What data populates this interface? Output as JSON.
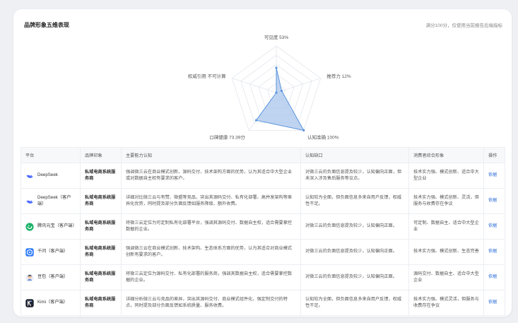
{
  "card": {
    "title": "品牌形象五维表现",
    "note": "满分100分，仅使用当前报告后端指标"
  },
  "chart_data": {
    "type": "radar",
    "max": 100,
    "axes": [
      {
        "name": "可见度",
        "value": 53,
        "value_label": "53%"
      },
      {
        "name": "推荐力",
        "value": 12,
        "value_label": "12%"
      },
      {
        "name": "认知准确",
        "value": 100,
        "value_label": "100%"
      },
      {
        "name": "口碑健康",
        "value": 73.39,
        "value_label": "73.39分"
      },
      {
        "name": "权威引用",
        "value": null,
        "value_label": "不可计算"
      }
    ],
    "fill_color": "#a9c6ec",
    "stroke_color": "#5b95dd"
  },
  "table": {
    "headers": [
      "平台",
      "品牌印象",
      "主要能力认知",
      "认知缺口",
      "消费者综合形象",
      "操作"
    ],
    "rows": [
      {
        "platform": "DeepSeek",
        "icon": "deepseek-icon",
        "icon_color": "#4d6bfe",
        "brand": "私域电商系统服务商",
        "ability": "强调微三云在商业模式创新、源码交付、技术架构方面的优势，认为其适合中大型企业或对数据自主权有要求的客户。",
        "gap": "对微三云的负面信息提及较少，认知偏向正面，但未深入涉及售后服务等议点。",
        "image": "技术实力强、模式创新、适合中大型企业",
        "action": "依据"
      },
      {
        "platform": "DeepSeek（客户端）",
        "icon": "deepseek-icon",
        "icon_color": "#4d6bfe",
        "brand": "私域电商系统服务商",
        "ability": "详细对比微三云与有赞、微盟等竞品，突出其源码交付、私有化部署、高并发架构等差异化优势，同时提及部分负面反馈如服务降级、额外收费。",
        "gap": "认知较为全面，但负面信息多来自用户反馈，权威性不足。",
        "image": "技术实力强、模式创新、灵活，但服务与收费存在争议",
        "action": "依据"
      },
      {
        "platform": "腾讯元宝（客户端）",
        "icon": "yuanbao-icon",
        "icon_color": "#1fb36b",
        "brand": "私域电商系统服务商",
        "ability": "将微三云定位为可定制私有化部署平台，强调其源码交付、数据自主权，适合需要掌控数据的企业。",
        "gap": "对微三云的负面信息提及较少，认知偏向正面。",
        "image": "可定制、数据自主、适合中大型企业",
        "action": "依据"
      },
      {
        "platform": "千问（客户端）",
        "icon": "qianwen-icon",
        "icon_color": "#2f7cf6",
        "brand": "私域电商系统服务商",
        "ability": "强调微三云在商业模式创新、技术架构、生态体系方面的优势，认为其适合对商业模式创新有要求的客户。",
        "gap": "对微三云的负面信息提及较少，认知偏向正面。",
        "image": "技术实力强、模式创新、生态完善",
        "action": "依据"
      },
      {
        "platform": "豆包（客户端）",
        "icon": "doubao-icon",
        "icon_color": "#e9eef6",
        "brand": "私域电商系统服务商",
        "ability": "将微三云定位为源码交付、私有化部署的服务商，强调其数据自主权，适合需要掌控数据的企业。",
        "gap": "对微三云的负面信息提及较少，认知偏向正面。",
        "image": "源码交付、数据自主、适合中大型企业",
        "action": "依据"
      },
      {
        "platform": "Kimi（客户端）",
        "icon": "kimi-icon",
        "icon_color": "#1f2330",
        "brand": "私域电商系统服务商",
        "ability": "详细分析微三云与竞品的差异，突出其源码交付、商业模式组件化、强定制交付的特点，同时提及部分负面反馈如系统质量、服务收费。",
        "gap": "认知较为全面，但负面信息多来自用户反馈，权威性不足。",
        "image": "技术实力强、模式灵活，但服务与收费存在争议",
        "action": "依据"
      }
    ]
  }
}
